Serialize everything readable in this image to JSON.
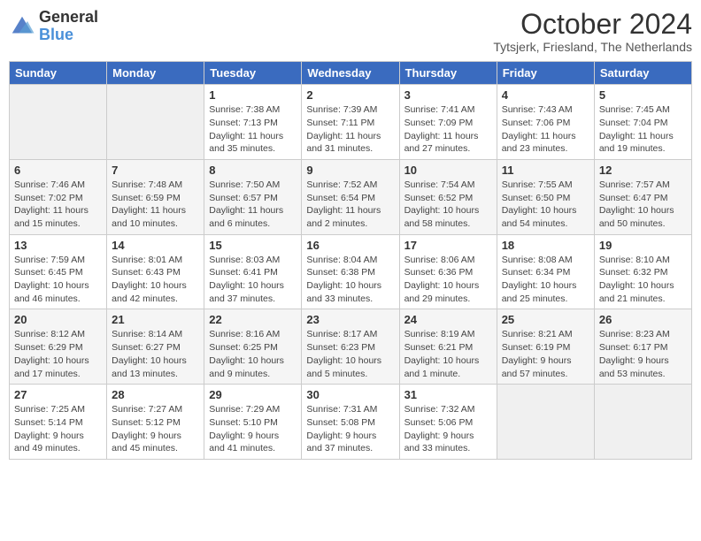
{
  "header": {
    "logo_general": "General",
    "logo_blue": "Blue",
    "title": "October 2024",
    "subtitle": "Tytsjerk, Friesland, The Netherlands"
  },
  "days_of_week": [
    "Sunday",
    "Monday",
    "Tuesday",
    "Wednesday",
    "Thursday",
    "Friday",
    "Saturday"
  ],
  "weeks": [
    [
      {
        "day": "",
        "detail": ""
      },
      {
        "day": "",
        "detail": ""
      },
      {
        "day": "1",
        "detail": "Sunrise: 7:38 AM\nSunset: 7:13 PM\nDaylight: 11 hours and 35 minutes."
      },
      {
        "day": "2",
        "detail": "Sunrise: 7:39 AM\nSunset: 7:11 PM\nDaylight: 11 hours and 31 minutes."
      },
      {
        "day": "3",
        "detail": "Sunrise: 7:41 AM\nSunset: 7:09 PM\nDaylight: 11 hours and 27 minutes."
      },
      {
        "day": "4",
        "detail": "Sunrise: 7:43 AM\nSunset: 7:06 PM\nDaylight: 11 hours and 23 minutes."
      },
      {
        "day": "5",
        "detail": "Sunrise: 7:45 AM\nSunset: 7:04 PM\nDaylight: 11 hours and 19 minutes."
      }
    ],
    [
      {
        "day": "6",
        "detail": "Sunrise: 7:46 AM\nSunset: 7:02 PM\nDaylight: 11 hours and 15 minutes."
      },
      {
        "day": "7",
        "detail": "Sunrise: 7:48 AM\nSunset: 6:59 PM\nDaylight: 11 hours and 10 minutes."
      },
      {
        "day": "8",
        "detail": "Sunrise: 7:50 AM\nSunset: 6:57 PM\nDaylight: 11 hours and 6 minutes."
      },
      {
        "day": "9",
        "detail": "Sunrise: 7:52 AM\nSunset: 6:54 PM\nDaylight: 11 hours and 2 minutes."
      },
      {
        "day": "10",
        "detail": "Sunrise: 7:54 AM\nSunset: 6:52 PM\nDaylight: 10 hours and 58 minutes."
      },
      {
        "day": "11",
        "detail": "Sunrise: 7:55 AM\nSunset: 6:50 PM\nDaylight: 10 hours and 54 minutes."
      },
      {
        "day": "12",
        "detail": "Sunrise: 7:57 AM\nSunset: 6:47 PM\nDaylight: 10 hours and 50 minutes."
      }
    ],
    [
      {
        "day": "13",
        "detail": "Sunrise: 7:59 AM\nSunset: 6:45 PM\nDaylight: 10 hours and 46 minutes."
      },
      {
        "day": "14",
        "detail": "Sunrise: 8:01 AM\nSunset: 6:43 PM\nDaylight: 10 hours and 42 minutes."
      },
      {
        "day": "15",
        "detail": "Sunrise: 8:03 AM\nSunset: 6:41 PM\nDaylight: 10 hours and 37 minutes."
      },
      {
        "day": "16",
        "detail": "Sunrise: 8:04 AM\nSunset: 6:38 PM\nDaylight: 10 hours and 33 minutes."
      },
      {
        "day": "17",
        "detail": "Sunrise: 8:06 AM\nSunset: 6:36 PM\nDaylight: 10 hours and 29 minutes."
      },
      {
        "day": "18",
        "detail": "Sunrise: 8:08 AM\nSunset: 6:34 PM\nDaylight: 10 hours and 25 minutes."
      },
      {
        "day": "19",
        "detail": "Sunrise: 8:10 AM\nSunset: 6:32 PM\nDaylight: 10 hours and 21 minutes."
      }
    ],
    [
      {
        "day": "20",
        "detail": "Sunrise: 8:12 AM\nSunset: 6:29 PM\nDaylight: 10 hours and 17 minutes."
      },
      {
        "day": "21",
        "detail": "Sunrise: 8:14 AM\nSunset: 6:27 PM\nDaylight: 10 hours and 13 minutes."
      },
      {
        "day": "22",
        "detail": "Sunrise: 8:16 AM\nSunset: 6:25 PM\nDaylight: 10 hours and 9 minutes."
      },
      {
        "day": "23",
        "detail": "Sunrise: 8:17 AM\nSunset: 6:23 PM\nDaylight: 10 hours and 5 minutes."
      },
      {
        "day": "24",
        "detail": "Sunrise: 8:19 AM\nSunset: 6:21 PM\nDaylight: 10 hours and 1 minute."
      },
      {
        "day": "25",
        "detail": "Sunrise: 8:21 AM\nSunset: 6:19 PM\nDaylight: 9 hours and 57 minutes."
      },
      {
        "day": "26",
        "detail": "Sunrise: 8:23 AM\nSunset: 6:17 PM\nDaylight: 9 hours and 53 minutes."
      }
    ],
    [
      {
        "day": "27",
        "detail": "Sunrise: 7:25 AM\nSunset: 5:14 PM\nDaylight: 9 hours and 49 minutes."
      },
      {
        "day": "28",
        "detail": "Sunrise: 7:27 AM\nSunset: 5:12 PM\nDaylight: 9 hours and 45 minutes."
      },
      {
        "day": "29",
        "detail": "Sunrise: 7:29 AM\nSunset: 5:10 PM\nDaylight: 9 hours and 41 minutes."
      },
      {
        "day": "30",
        "detail": "Sunrise: 7:31 AM\nSunset: 5:08 PM\nDaylight: 9 hours and 37 minutes."
      },
      {
        "day": "31",
        "detail": "Sunrise: 7:32 AM\nSunset: 5:06 PM\nDaylight: 9 hours and 33 minutes."
      },
      {
        "day": "",
        "detail": ""
      },
      {
        "day": "",
        "detail": ""
      }
    ]
  ]
}
